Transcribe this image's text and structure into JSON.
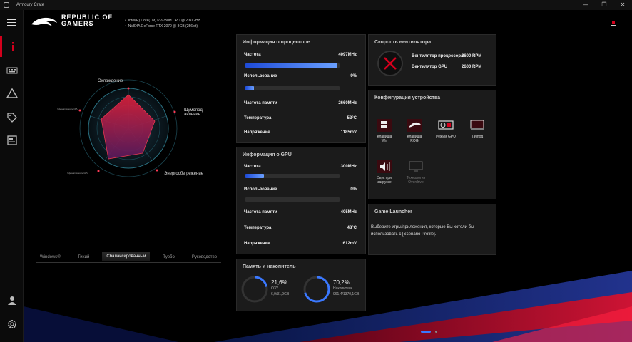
{
  "window": {
    "title": "Armoury Crate",
    "minimize": "—",
    "maximize": "❐",
    "close": "✕"
  },
  "brand": {
    "line1": "REPUBLIC OF",
    "line2": "GAMERS"
  },
  "specs": {
    "cpu": "Intel(R) Core(TM) i7-9750H CPU @ 2.60GHz",
    "gpu": "NVIDIA GeForce RTX 2070 @ 8GB (256bit)"
  },
  "sidebar": {
    "items": [
      {
        "icon": "info-icon"
      },
      {
        "icon": "keyboard-icon"
      },
      {
        "icon": "aura-triangle-icon"
      },
      {
        "icon": "tag-icon"
      },
      {
        "icon": "scenario-icon"
      },
      {
        "icon": "user-icon"
      },
      {
        "icon": "settings-icon"
      }
    ]
  },
  "radar": {
    "labels": {
      "top": "Охлаждение",
      "right_line1": "Шумопод",
      "right_line2": "авление",
      "bottom_right": "Энергосбе режение",
      "small_left_top": "Эффективность CPU",
      "small_left_bottom": "Эффективность GPU"
    }
  },
  "modes": {
    "tabs": [
      "Windows®",
      "Тихий",
      "Сбалансированный",
      "Турбо",
      "Руководство"
    ],
    "active_index": 2
  },
  "cpu_panel": {
    "title": "Информация о процессоре",
    "freq_label": "Частота",
    "freq_value": "4097MHz",
    "freq_bar": 0.98,
    "usage_label": "Использование",
    "usage_value": "9%",
    "usage_bar": 0.09,
    "mem_label": "Частота памяти",
    "mem_value": "2660MHz",
    "temp_label": "Температура",
    "temp_value": "52°C",
    "volt_label": "Напряжение",
    "volt_value": "1185mV"
  },
  "gpu_panel": {
    "title": "Информация о GPU",
    "freq_label": "Частота",
    "freq_value": "300MHz",
    "freq_bar": 0.2,
    "usage_label": "Использование",
    "usage_value": "0%",
    "usage_bar": 0.0,
    "mem_label": "Частота памяти",
    "mem_value": "405MHz",
    "temp_label": "Температура",
    "temp_value": "48°C",
    "volt_label": "Напряжение",
    "volt_value": "612mV"
  },
  "fan_panel": {
    "title": "Скорость вентилятора",
    "cpu_label": "Вентилятор процессора",
    "cpu_value": "2600 RPM",
    "gpu_label": "Вентилятор GPU",
    "gpu_value": "2600 RPM"
  },
  "config_panel": {
    "title": "Конфигурация устройства",
    "items": [
      {
        "label1": "Клавиша",
        "label2": "Win"
      },
      {
        "label1": "Клавиша",
        "label2": "ROG"
      },
      {
        "label1": "Режим GPU",
        "label2": ""
      },
      {
        "label1": "Тачпод",
        "label2": ""
      },
      {
        "label1": "Звук при",
        "label2": "загрузке"
      },
      {
        "label1": "Технология",
        "label2": "Overdrive"
      }
    ]
  },
  "launcher_panel": {
    "title": "Game Launcher",
    "text": "Выберите игры/приложения, которые Вы хотели бы использовать с [Scenario Profile]."
  },
  "storage_panel": {
    "title": "Память и накопитель",
    "ram_percent": "21,6%",
    "ram_label": "ОЗУ",
    "ram_detail": "6,9/31,9GB",
    "ram_fraction": 0.216,
    "disk_percent": "70,2%",
    "disk_label": "Накопитель",
    "disk_detail": "961,4/1370,1GB",
    "disk_fraction": 0.702
  },
  "colors": {
    "accent": "#d4001c",
    "bar": "#1e4bd8"
  }
}
